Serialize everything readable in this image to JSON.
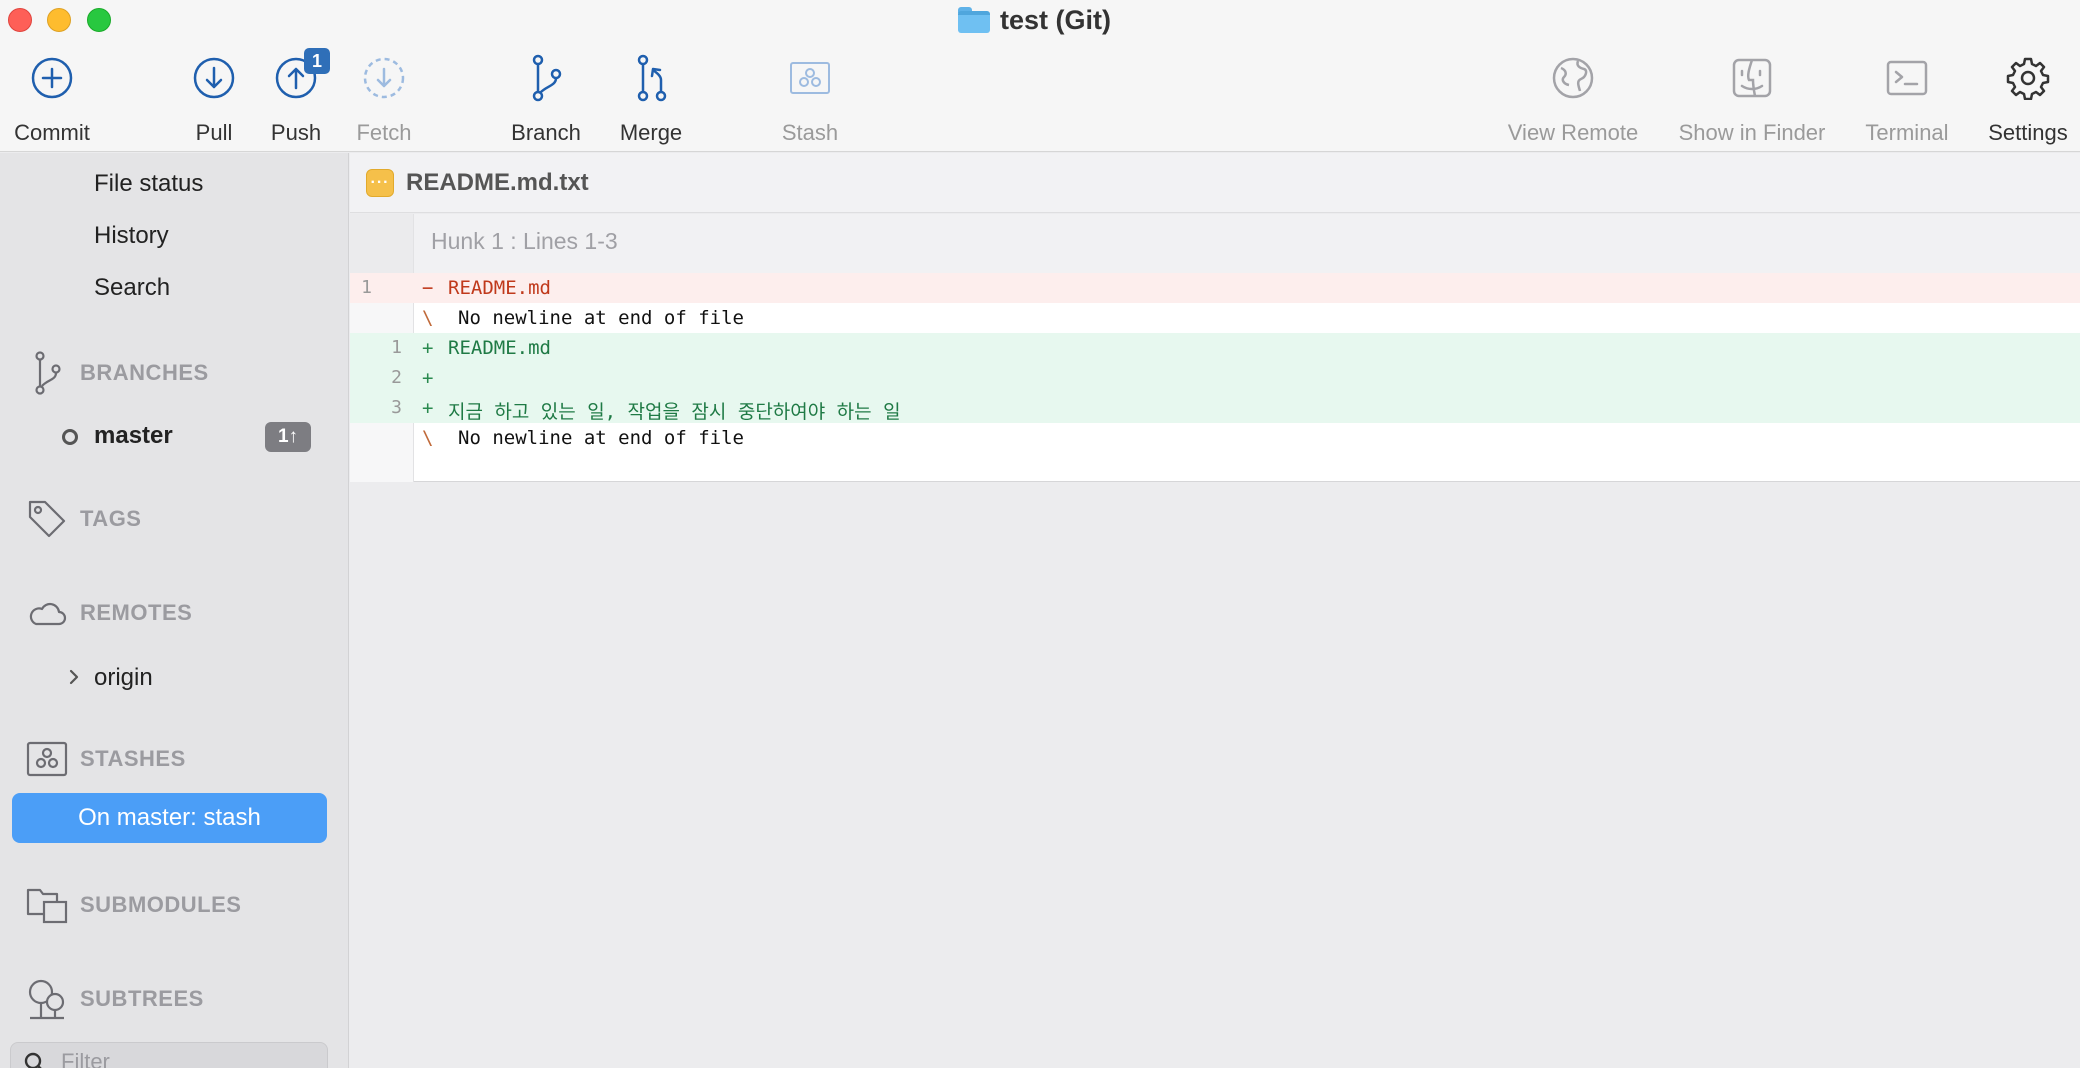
{
  "window": {
    "title": "test (Git)"
  },
  "toolbar": {
    "commit": "Commit",
    "pull": "Pull",
    "push": "Push",
    "push_badge": "1",
    "fetch": "Fetch",
    "branch": "Branch",
    "merge": "Merge",
    "stash": "Stash",
    "view_remote": "View Remote",
    "show_in_finder": "Show in Finder",
    "terminal": "Terminal",
    "settings": "Settings"
  },
  "sidebar": {
    "workspace": [
      "File status",
      "History",
      "Search"
    ],
    "branches_title": "BRANCHES",
    "branch": {
      "name": "master",
      "badge": "1↑"
    },
    "tags_title": "TAGS",
    "remotes_title": "REMOTES",
    "remote": {
      "name": "origin"
    },
    "stashes_title": "STASHES",
    "stash_item": "On master: stash",
    "submodules_title": "SUBMODULES",
    "subtrees_title": "SUBTREES",
    "filter_placeholder": "Filter"
  },
  "diff": {
    "file_name": "README.md.txt",
    "hunk_title": "Hunk 1 : Lines 1-3",
    "lines": [
      {
        "type": "del",
        "old": "1",
        "new": "",
        "sign": "−",
        "text": "README.md"
      },
      {
        "type": "ctx",
        "old": "",
        "new": "",
        "sign": "\\",
        "text": "No newline at end of file"
      },
      {
        "type": "add",
        "old": "",
        "new": "1",
        "sign": "+",
        "text": "README.md"
      },
      {
        "type": "add",
        "old": "",
        "new": "2",
        "sign": "+",
        "text": ""
      },
      {
        "type": "add",
        "old": "",
        "new": "3",
        "sign": "+",
        "text": "지금 하고 있는 일, 작업을 잠시 중단하여야 하는 일"
      },
      {
        "type": "ctx",
        "old": "",
        "new": "",
        "sign": "\\",
        "text": "No newline at end of file"
      }
    ]
  },
  "colors": {
    "accent": "#4b9ef7",
    "toolbar_icon": "#1f5fae",
    "deleted_bg": "#fdeeed",
    "added_bg": "#e7f8ef"
  },
  "icons": {
    "commit": "plus-circle-icon",
    "pull": "arrow-down-circle-icon",
    "push": "arrow-up-circle-icon",
    "fetch": "dashed-arrow-down-circle-icon",
    "branch": "branch-icon",
    "merge": "merge-icon",
    "stash": "stash-box-icon",
    "view_remote": "globe-icon",
    "show_in_finder": "finder-icon",
    "terminal": "terminal-icon",
    "settings": "gear-icon"
  }
}
